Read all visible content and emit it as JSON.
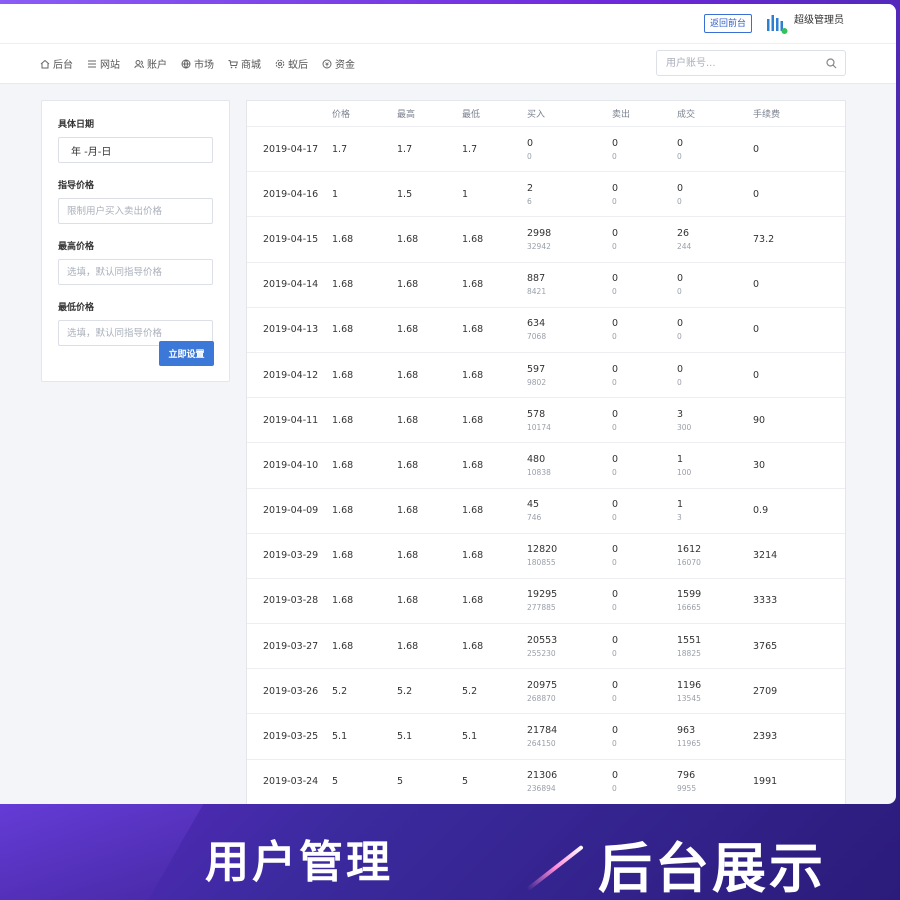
{
  "header": {
    "back_label": "返回前台",
    "admin_name": "超级管理员",
    "logo_icon": "admin-bars-logo"
  },
  "nav": {
    "items": [
      {
        "label": "后台",
        "icon": "home-icon"
      },
      {
        "label": "网站",
        "icon": "list-icon"
      },
      {
        "label": "账户",
        "icon": "users-icon"
      },
      {
        "label": "市场",
        "icon": "globe-icon"
      },
      {
        "label": "商城",
        "icon": "cart-icon"
      },
      {
        "label": "蚁后",
        "icon": "settings-icon"
      },
      {
        "label": "资金",
        "icon": "coin-icon"
      }
    ],
    "search_placeholder": "用户账号..."
  },
  "form": {
    "date_label": "具体日期",
    "date_value": "年 -月-日",
    "guide_label": "指导价格",
    "guide_placeholder": "限制用户买入卖出价格",
    "high_label": "最高价格",
    "high_placeholder": "选填，默认同指导价格",
    "low_label": "最低价格",
    "low_placeholder": "选填，默认同指导价格",
    "submit_label": "立即设置"
  },
  "table": {
    "headers": [
      "",
      "价格",
      "最高",
      "最低",
      "买入",
      "卖出",
      "成交",
      "手续费"
    ],
    "rows": [
      {
        "date": "2019-04-17",
        "price": "1.7",
        "high": "1.7",
        "low": "1.7",
        "buy": "0",
        "buy_sub": "0",
        "sell": "0",
        "sell_sub": "0",
        "deal": "0",
        "deal_sub": "0",
        "fee": "0"
      },
      {
        "date": "2019-04-16",
        "price": "1",
        "high": "1.5",
        "low": "1",
        "buy": "2",
        "buy_sub": "6",
        "sell": "0",
        "sell_sub": "0",
        "deal": "0",
        "deal_sub": "0",
        "fee": "0"
      },
      {
        "date": "2019-04-15",
        "price": "1.68",
        "high": "1.68",
        "low": "1.68",
        "buy": "2998",
        "buy_sub": "32942",
        "sell": "0",
        "sell_sub": "0",
        "deal": "26",
        "deal_sub": "244",
        "fee": "73.2"
      },
      {
        "date": "2019-04-14",
        "price": "1.68",
        "high": "1.68",
        "low": "1.68",
        "buy": "887",
        "buy_sub": "8421",
        "sell": "0",
        "sell_sub": "0",
        "deal": "0",
        "deal_sub": "0",
        "fee": "0"
      },
      {
        "date": "2019-04-13",
        "price": "1.68",
        "high": "1.68",
        "low": "1.68",
        "buy": "634",
        "buy_sub": "7068",
        "sell": "0",
        "sell_sub": "0",
        "deal": "0",
        "deal_sub": "0",
        "fee": "0"
      },
      {
        "date": "2019-04-12",
        "price": "1.68",
        "high": "1.68",
        "low": "1.68",
        "buy": "597",
        "buy_sub": "9802",
        "sell": "0",
        "sell_sub": "0",
        "deal": "0",
        "deal_sub": "0",
        "fee": "0"
      },
      {
        "date": "2019-04-11",
        "price": "1.68",
        "high": "1.68",
        "low": "1.68",
        "buy": "578",
        "buy_sub": "10174",
        "sell": "0",
        "sell_sub": "0",
        "deal": "3",
        "deal_sub": "300",
        "fee": "90"
      },
      {
        "date": "2019-04-10",
        "price": "1.68",
        "high": "1.68",
        "low": "1.68",
        "buy": "480",
        "buy_sub": "10838",
        "sell": "0",
        "sell_sub": "0",
        "deal": "1",
        "deal_sub": "100",
        "fee": "30"
      },
      {
        "date": "2019-04-09",
        "price": "1.68",
        "high": "1.68",
        "low": "1.68",
        "buy": "45",
        "buy_sub": "746",
        "sell": "0",
        "sell_sub": "0",
        "deal": "1",
        "deal_sub": "3",
        "fee": "0.9"
      },
      {
        "date": "2019-03-29",
        "price": "1.68",
        "high": "1.68",
        "low": "1.68",
        "buy": "12820",
        "buy_sub": "180855",
        "sell": "0",
        "sell_sub": "0",
        "deal": "1612",
        "deal_sub": "16070",
        "fee": "3214"
      },
      {
        "date": "2019-03-28",
        "price": "1.68",
        "high": "1.68",
        "low": "1.68",
        "buy": "19295",
        "buy_sub": "277885",
        "sell": "0",
        "sell_sub": "0",
        "deal": "1599",
        "deal_sub": "16665",
        "fee": "3333"
      },
      {
        "date": "2019-03-27",
        "price": "1.68",
        "high": "1.68",
        "low": "1.68",
        "buy": "20553",
        "buy_sub": "255230",
        "sell": "0",
        "sell_sub": "0",
        "deal": "1551",
        "deal_sub": "18825",
        "fee": "3765"
      },
      {
        "date": "2019-03-26",
        "price": "5.2",
        "high": "5.2",
        "low": "5.2",
        "buy": "20975",
        "buy_sub": "268870",
        "sell": "0",
        "sell_sub": "0",
        "deal": "1196",
        "deal_sub": "13545",
        "fee": "2709"
      },
      {
        "date": "2019-03-25",
        "price": "5.1",
        "high": "5.1",
        "low": "5.1",
        "buy": "21784",
        "buy_sub": "264150",
        "sell": "0",
        "sell_sub": "0",
        "deal": "963",
        "deal_sub": "11965",
        "fee": "2393"
      },
      {
        "date": "2019-03-24",
        "price": "5",
        "high": "5",
        "low": "5",
        "buy": "21306",
        "buy_sub": "236894",
        "sell": "0",
        "sell_sub": "0",
        "deal": "796",
        "deal_sub": "9955",
        "fee": "1991"
      }
    ]
  },
  "banner": {
    "left": "用户管理",
    "right": "后台展示"
  },
  "colors": {
    "accent": "#3b78d8",
    "banner_bg": "#5b2fd6"
  }
}
